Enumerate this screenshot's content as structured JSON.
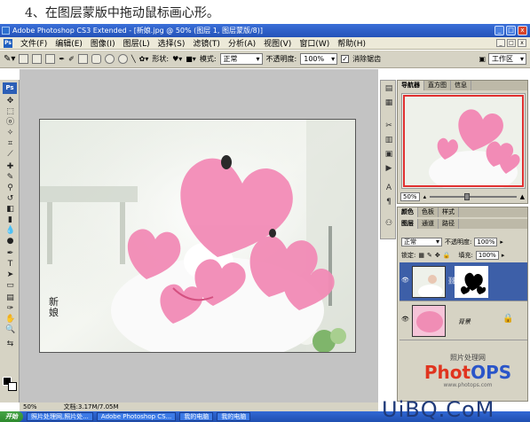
{
  "caption": "4、在图层蒙版中拖动鼠标画心形。",
  "window": {
    "title": "Adobe Photoshop CS3 Extended - [新娘.jpg @ 50% (图层 1, 图层蒙版/8)]",
    "controls": [
      "_",
      "□",
      "x"
    ]
  },
  "menubar": {
    "logo": "Ps",
    "items": [
      "文件(F)",
      "编辑(E)",
      "图像(I)",
      "图层(L)",
      "选择(S)",
      "滤镜(T)",
      "分析(A)",
      "视图(V)",
      "窗口(W)",
      "帮助(H)"
    ]
  },
  "options": {
    "shape_label": "形状:",
    "mode_label": "模式:",
    "mode_value": "正常",
    "opacity_label": "不透明度:",
    "opacity_value": "100%",
    "antialias_label": "消除锯齿",
    "workspace_label": "工作区"
  },
  "toolbox": {
    "logo": "Ps"
  },
  "canvas": {
    "signature": "新娘"
  },
  "status": {
    "zoom": "50%",
    "doc": "文档:3.17M/7.05M"
  },
  "navigator": {
    "tabs": [
      "导航器",
      "直方图",
      "信息"
    ],
    "zoom": "50%"
  },
  "layers": {
    "tabs1": [
      "颜色",
      "色板",
      "样式"
    ],
    "tabs2": [
      "图层",
      "通道",
      "路径"
    ],
    "blend_mode": "正常",
    "opacity_label": "不透明度:",
    "opacity_value": "100%",
    "lock_label": "锁定:",
    "fill_label": "填充:",
    "fill_value": "100%",
    "items": [
      {
        "name": "",
        "selected": true
      },
      {
        "name": "背景",
        "selected": false
      }
    ]
  },
  "logo": {
    "site": "照片处理网",
    "brand_red": "Phot",
    "brand_blue": "OPS",
    "url": "www.photops.com"
  },
  "taskbar": {
    "start": "开始",
    "items": [
      "照片处理网,照片处...",
      "Adobe Photoshop CS...",
      "我的电脑",
      "我的电脑"
    ]
  },
  "watermark": "UiBQ.CoM",
  "colors": {
    "heart": "#f07fae",
    "titlebar": "#2452b8",
    "panel": "#d6d3c4"
  }
}
